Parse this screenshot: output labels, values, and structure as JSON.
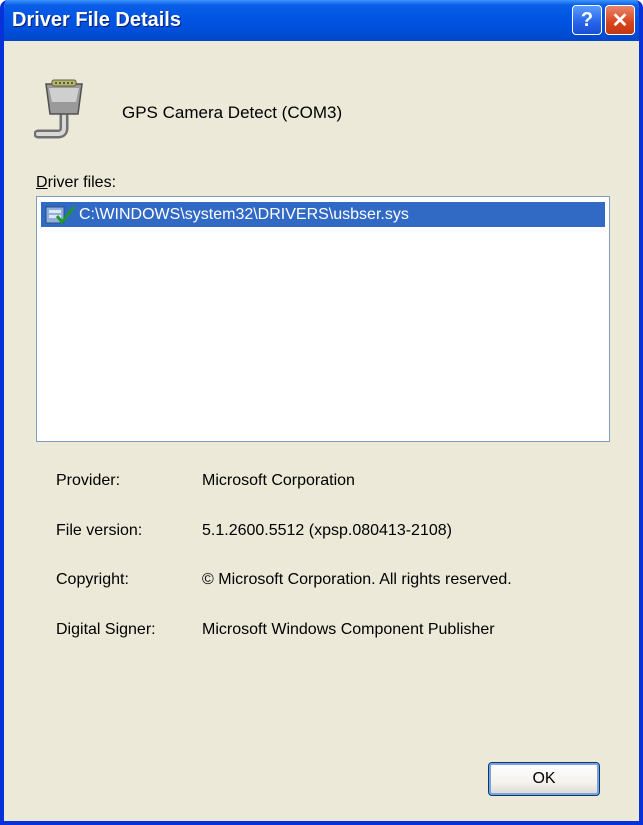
{
  "window": {
    "title": "Driver File Details",
    "help_glyph": "?",
    "close_glyph": "✕"
  },
  "device": {
    "icon": "serial-port-icon",
    "name": "GPS Camera Detect (COM3)"
  },
  "driver_files": {
    "label_accel": "D",
    "label_rest": "river files:",
    "items": [
      {
        "icon": "signed-file-icon",
        "path": "C:\\WINDOWS\\system32\\DRIVERS\\usbser.sys",
        "selected": true
      }
    ]
  },
  "details": [
    {
      "label": "Provider:",
      "value": "Microsoft Corporation"
    },
    {
      "label": "File version:",
      "value": "5.1.2600.5512 (xpsp.080413-2108)"
    },
    {
      "label": "Copyright:",
      "value": "© Microsoft Corporation. All rights reserved."
    },
    {
      "label": "Digital Signer:",
      "value": "Microsoft Windows Component Publisher"
    }
  ],
  "buttons": {
    "ok_label": "OK"
  },
  "colors": {
    "titlebar": "#0054e3",
    "selection": "#316ac5",
    "dialog_bg": "#ece9d8"
  }
}
